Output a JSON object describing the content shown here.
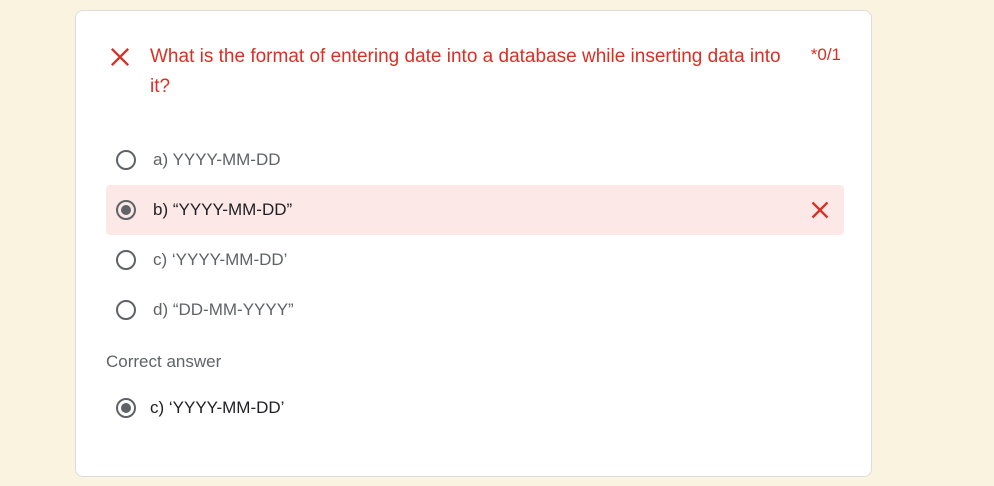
{
  "question": {
    "text": "What is the format of entering date into a database while inserting data into it?",
    "score": "*0/1",
    "status_icon": "close-icon",
    "status_color": "#d93025"
  },
  "options": [
    {
      "label": "a) YYYY-MM-DD",
      "selected": false
    },
    {
      "label": "b) “YYYY-MM-DD”",
      "selected": true,
      "marked_wrong": true
    },
    {
      "label": "c) ‘YYYY-MM-DD’",
      "selected": false
    },
    {
      "label": "d) “DD-MM-YYYY”",
      "selected": false
    }
  ],
  "correct": {
    "title": "Correct answer",
    "label": "c) ‘YYYY-MM-DD’"
  },
  "colors": {
    "page_background": "#faf3df",
    "wrong_highlight": "#fce8e6",
    "error": "#d93025"
  }
}
